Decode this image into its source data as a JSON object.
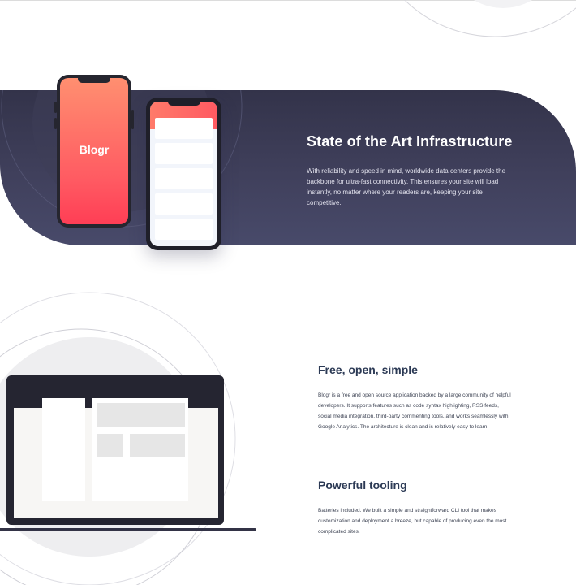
{
  "phone": {
    "logo": "Blogr"
  },
  "infrastructure": {
    "title": "State of the Art Infrastructure",
    "text": "With reliability and speed in mind, worldwide data centers provide the backbone for ultra-fast connectivity. This ensures your site will load instantly, no matter where your readers are, keeping your site competitive."
  },
  "features": [
    {
      "title": "Free, open, simple",
      "text": "Blogr is a free and open source application backed by a large community of helpful developers. It supports features such as code syntax highlighting, RSS feeds, social media integration, third-party commenting tools, and works seamlessly with Google Analytics. The architecture is clean and is relatively easy to learn."
    },
    {
      "title": "Powerful tooling",
      "text": "Batteries included. We built a simple and straightforward CLI tool that makes customization and deployment a breeze, but capable of producing even the most complicated sites."
    }
  ],
  "colors": {
    "band_dark": "#33334a",
    "band_light": "#484a6a",
    "accent_start": "#ff8f70",
    "accent_end": "#ff3e55",
    "heading": "#2c3a55"
  }
}
